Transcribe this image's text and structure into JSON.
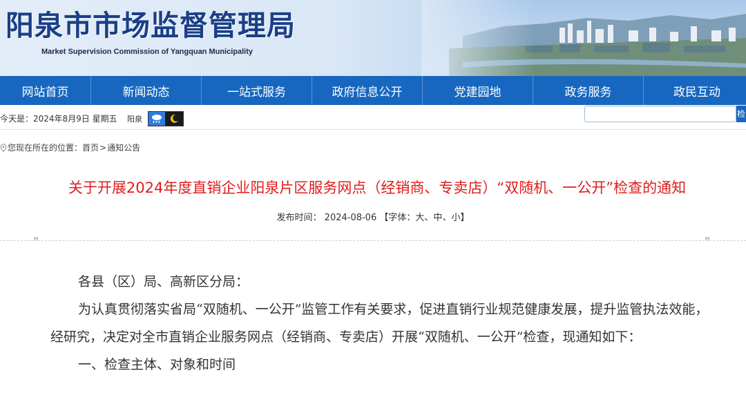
{
  "banner": {
    "title_cn": "阳泉市市场监督管理局",
    "title_en": "Market Supervision Commission of Yangquan Municipality"
  },
  "nav": {
    "items": [
      {
        "label": "网站首页"
      },
      {
        "label": "新闻动态"
      },
      {
        "label": "一站式服务"
      },
      {
        "label": "政府信息公开"
      },
      {
        "label": "党建园地"
      },
      {
        "label": "政务服务"
      },
      {
        "label": "政民互动"
      }
    ]
  },
  "infobar": {
    "date": "今天是：2024年8月9日 星期五",
    "city": "阳泉",
    "weather_icons": [
      "rain-cloud-icon",
      "moon-icon"
    ],
    "search_button": "检"
  },
  "breadcrumb": {
    "prefix": "您现在所在的位置：",
    "home": "首页",
    "separator": ">",
    "current": "通知公告"
  },
  "article": {
    "title": "关于开展2024年度直销企业阳泉片区服务网点（经销商、专卖店）“双随机、一公开”检查的通知",
    "meta": {
      "publish_label": "发布时间：",
      "publish_date": "2024-08-06",
      "font_label": "【字体：",
      "font_large": "大",
      "font_medium": "中",
      "font_small": "小",
      "font_close": "】"
    },
    "paragraphs": [
      "各县（区）局、高新区分局：",
      "为认真贯彻落实省局“双随机、一公开”监管工作有关要求，促进直销行业规范健康发展，提升监管执法效能，经研究，决定对全市直销企业服务网点（经销商、专卖店）开展“双随机、一公开”检查，现通知如下：",
      "一、检查主体、对象和时间"
    ]
  },
  "colors": {
    "nav_bg": "#1767c0",
    "title_red": "#e01c1c",
    "banner_title": "#1b3f86"
  }
}
